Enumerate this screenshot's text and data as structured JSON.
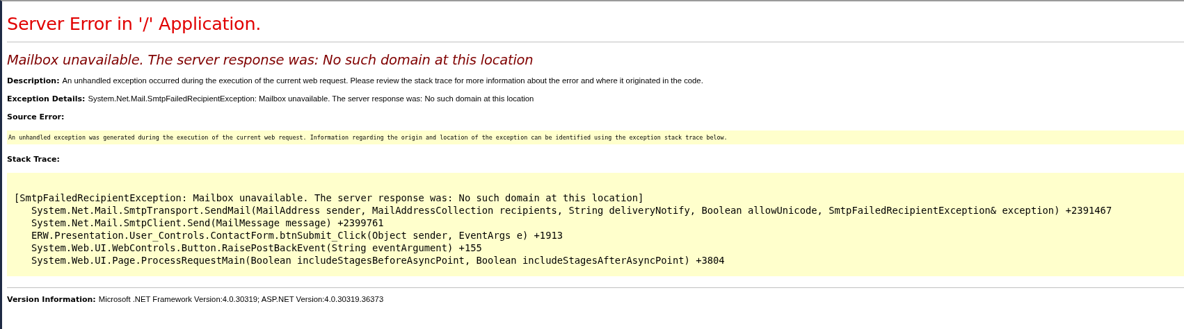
{
  "title": "Server Error in '/' Application.",
  "error_message": "Mailbox unavailable. The server response was: No such domain at this location",
  "details": [
    {
      "label": "Description:",
      "text": "An unhandled exception occurred during the execution of the current web request. Please review the stack trace for more information about the error and where it originated in the code."
    },
    {
      "label": "Exception Details:",
      "text": "System.Net.Mail.SmtpFailedRecipientException: Mailbox unavailable. The server response was: No such domain at this location"
    }
  ],
  "source_error": {
    "label": "Source Error:",
    "text": "An unhandled exception was generated during the execution of the current web request. Information regarding the origin and location of the exception can be identified using the exception stack trace below."
  },
  "stack_trace": {
    "label": "Stack Trace:",
    "lines": [
      {
        "kind": "header",
        "text": "[SmtpFailedRecipientException: Mailbox unavailable. The server response was: No such domain at this location]"
      },
      {
        "kind": "frame",
        "text": "System.Net.Mail.SmtpTransport.SendMail(MailAddress sender, MailAddressCollection recipients, String deliveryNotify, Boolean allowUnicode, SmtpFailedRecipientException& exception) +2391467"
      },
      {
        "kind": "frame",
        "text": "System.Net.Mail.SmtpClient.Send(MailMessage message) +2399761"
      },
      {
        "kind": "frame",
        "text": "ERW.Presentation.User_Controls.ContactForm.btnSubmit_Click(Object sender, EventArgs e) +1913"
      },
      {
        "kind": "frame",
        "text": "System.Web.UI.WebControls.Button.RaisePostBackEvent(String eventArgument) +155"
      },
      {
        "kind": "frame",
        "text": "System.Web.UI.Page.ProcessRequestMain(Boolean includeStagesBeforeAsyncPoint, Boolean includeStagesAfterAsyncPoint) +3804"
      }
    ]
  },
  "version": {
    "label": "Version Information:",
    "text": "Microsoft .NET Framework Version:4.0.30319; ASP.NET Version:4.0.30319.36373"
  }
}
